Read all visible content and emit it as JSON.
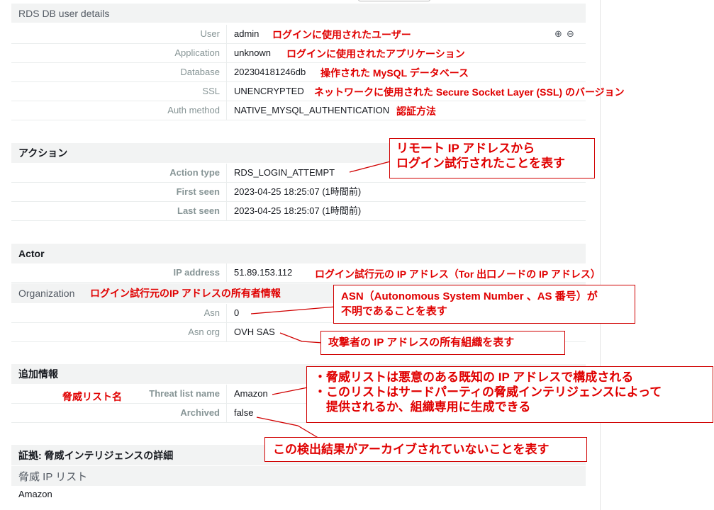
{
  "rds_user": {
    "title": "RDS DB user details",
    "rows": [
      {
        "label": "User",
        "value": "admin",
        "note": "ログインに使用されたユーザー"
      },
      {
        "label": "Application",
        "value": "unknown",
        "note": "ログインに使用されたアプリケーション"
      },
      {
        "label": "Database",
        "value": "202304181246db",
        "note": "操作された MySQL データベース"
      },
      {
        "label": "SSL",
        "value": "UNENCRYPTED",
        "note": "ネットワークに使用された Secure Socket Layer (SSL) のバージョン"
      },
      {
        "label": "Auth method",
        "value": "NATIVE_MYSQL_AUTHENTICATION",
        "note": "認証方法"
      }
    ],
    "zoom_in": "⊕",
    "zoom_out": "⊖"
  },
  "action": {
    "title": "アクション",
    "rows": [
      {
        "label": "Action type",
        "value": "RDS_LOGIN_ATTEMPT"
      },
      {
        "label": "First seen",
        "value": "2023-04-25 18:25:07 (1時間前)"
      },
      {
        "label": "Last seen",
        "value": "2023-04-25 18:25:07 (1時間前)"
      }
    ],
    "callout_line1": "リモート IP アドレスから",
    "callout_line2": "ログイン試行されたことを表す"
  },
  "actor": {
    "title": "Actor",
    "ip_label": "IP address",
    "ip_value": "51.89.153.112",
    "ip_note": "ログイン試行元の IP アドレス（Tor 出口ノードの IP アドレス）",
    "org_title": "Organization",
    "org_note": "ログイン試行元のIP アドレスの所有者情報",
    "asn_label": "Asn",
    "asn_value": "0",
    "asnorg_label": "Asn org",
    "asnorg_value": "OVH SAS",
    "asn_callout_line1": "ASN（Autonomous System Number 、AS 番号）が",
    "asn_callout_line2": "不明であることを表す",
    "asnorg_callout": "攻撃者の IP アドレスの所有組織を表す"
  },
  "extra": {
    "title": "追加情報",
    "threat_label": "Threat list name",
    "threat_value": "Amazon",
    "threat_note": "脅威リスト名",
    "archived_label": "Archived",
    "archived_value": "false",
    "threat_callout_line1": "・脅威リストは悪意のある既知の IP アドレスで構成される",
    "threat_callout_line2": "・このリストはサードパーティの脅威インテリジェンスによって",
    "threat_callout_line3": "　提供されるか、組織専用に生成できる",
    "archived_callout": "この検出結果がアーカイブされていないことを表す"
  },
  "evidence": {
    "title": "証拠: 脅威インテリジェンスの詳細",
    "sub_title": "脅威 IP リスト",
    "value": "Amazon"
  }
}
